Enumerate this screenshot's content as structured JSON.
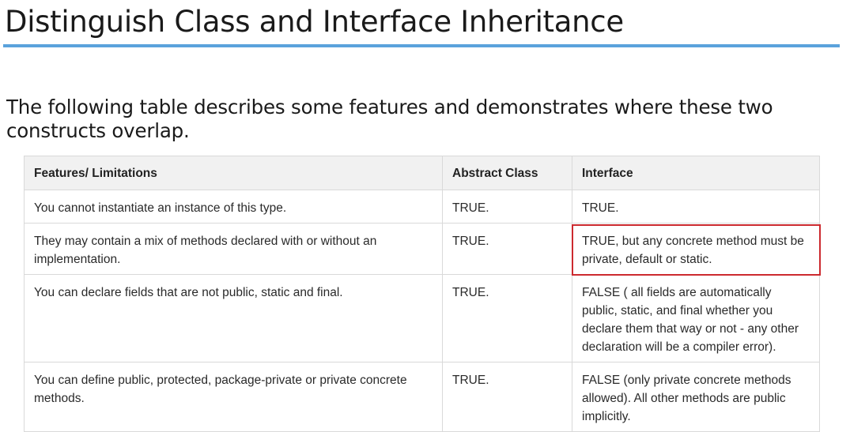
{
  "page": {
    "title": "Distinguish Class and Interface Inheritance",
    "intro": "The following table describes some features and demonstrates where these two constructs overlap.",
    "accent_color": "#5aa2dc",
    "highlight_color": "#cc2a2f"
  },
  "table": {
    "headers": [
      "Features/ Limitations",
      "Abstract Class",
      "Interface"
    ],
    "rows": [
      {
        "feature": "You cannot instantiate an instance of this type.",
        "abstract_class": "TRUE.",
        "interface": "TRUE."
      },
      {
        "feature": "They may contain a mix of methods declared with or without an implementation.",
        "abstract_class": "TRUE.",
        "interface": "TRUE, but any concrete method must be private, default or static."
      },
      {
        "feature": "You can declare fields that are not public, static and final.",
        "abstract_class": "TRUE.",
        "interface": "FALSE ( all fields are automatically public, static, and final whether you declare them that way or not - any other declaration will be a compiler error)."
      },
      {
        "feature": "You can define public, protected, package-private or private concrete methods.",
        "abstract_class": "TRUE.",
        "interface": "FALSE (only private concrete methods allowed).  All other methods are public implicitly."
      }
    ]
  }
}
